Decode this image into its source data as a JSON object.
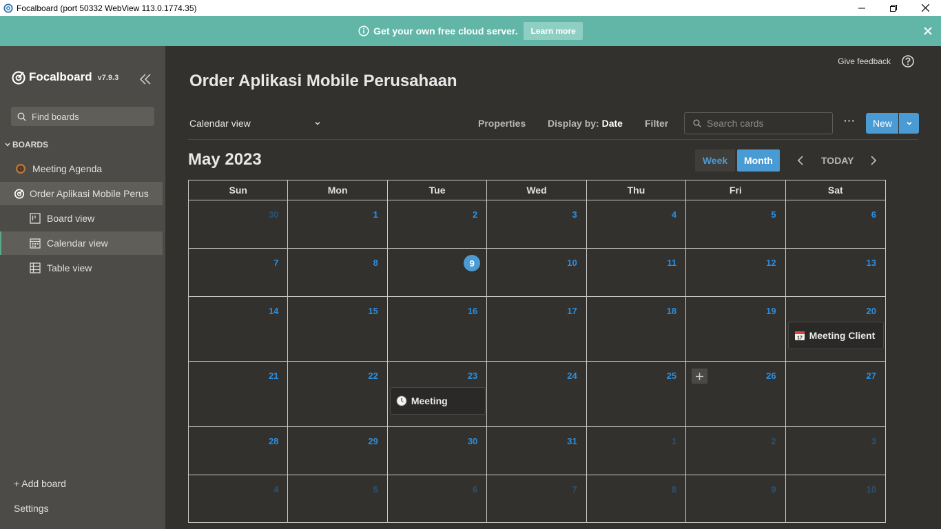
{
  "window": {
    "title": "Focalboard (port 50332 WebView 113.0.1774.35)"
  },
  "banner": {
    "text": "Get your own free cloud server.",
    "button": "Learn more"
  },
  "sidebar": {
    "brand": "Focalboard",
    "version": "v7.9.3",
    "search_placeholder": "Find boards",
    "boards_header": "BOARDS",
    "boards": [
      {
        "label": "Meeting Agenda",
        "icon": "donut-icon"
      },
      {
        "label": "Order Aplikasi Mobile Perus",
        "icon": "focalboard-icon"
      }
    ],
    "views": [
      {
        "label": "Board view",
        "icon": "board-view-icon"
      },
      {
        "label": "Calendar view",
        "icon": "calendar-view-icon"
      },
      {
        "label": "Table view",
        "icon": "table-view-icon"
      }
    ],
    "add_board": "+ Add board",
    "settings": "Settings"
  },
  "header": {
    "feedback": "Give feedback",
    "board_title": "Order Aplikasi Mobile Perusahaan",
    "view_name": "Calendar view",
    "properties": "Properties",
    "display_by_label": "Display by:",
    "display_by_value": "Date",
    "filter": "Filter",
    "search_placeholder": "Search cards",
    "more": "···",
    "new": "New"
  },
  "calendar": {
    "month_title": "May 2023",
    "week": "Week",
    "month": "Month",
    "today": "TODAY",
    "weekdays": [
      "Sun",
      "Mon",
      "Tue",
      "Wed",
      "Thu",
      "Fri",
      "Sat"
    ],
    "weeks": [
      [
        "30",
        "1",
        "2",
        "3",
        "4",
        "5",
        "6"
      ],
      [
        "7",
        "8",
        "9",
        "10",
        "11",
        "12",
        "13"
      ],
      [
        "14",
        "15",
        "16",
        "17",
        "18",
        "19",
        "20"
      ],
      [
        "21",
        "22",
        "23",
        "24",
        "25",
        "26",
        "27"
      ],
      [
        "28",
        "29",
        "30",
        "31",
        "1",
        "2",
        "3"
      ],
      [
        "4",
        "5",
        "6",
        "7",
        "8",
        "9",
        "10"
      ]
    ],
    "events": [
      {
        "label": "Meeting Client",
        "icon": "calendar-emoji-icon"
      },
      {
        "label": "Meeting",
        "icon": "clock-emoji-icon"
      }
    ]
  }
}
